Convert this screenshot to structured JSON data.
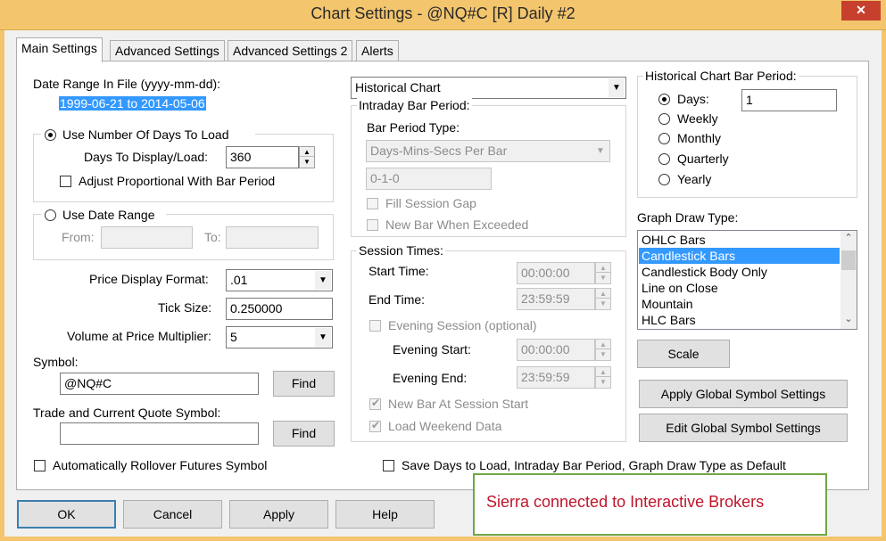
{
  "window": {
    "title": "Chart Settings - @NQ#C [R]  Daily  #2",
    "close_glyph": "✕"
  },
  "tabs": [
    "Main Settings",
    "Advanced Settings",
    "Advanced Settings 2",
    "Alerts"
  ],
  "main": {
    "date_range_label": "Date Range In File (yyyy-mm-dd):",
    "date_range_value": "1999-06-21 to 2014-05-06",
    "use_days_label": "Use Number Of Days To Load",
    "days_label": "Days To Display/Load:",
    "days_value": "360",
    "adjust_label": "Adjust Proportional With Bar Period",
    "use_date_range_label": "Use Date Range",
    "from_label": "From:",
    "to_label": "To:",
    "price_format_label": "Price Display Format:",
    "price_format_value": ".01",
    "tick_size_label": "Tick Size:",
    "tick_size_value": "0.250000",
    "volume_label": "Volume at Price Multiplier:",
    "volume_value": "5",
    "symbol_label": "Symbol:",
    "symbol_value": "@NQ#C",
    "find_label": "Find",
    "trade_symbol_label": "Trade and Current Quote Symbol:",
    "trade_symbol_value": "",
    "rollover_label": "Automatically Rollover Futures Symbol"
  },
  "middle": {
    "chart_type_value": "Historical Chart",
    "intraday_group": "Intraday Bar Period:",
    "bar_period_type_label": "Bar Period Type:",
    "bar_period_type_value": "Days-Mins-Secs Per Bar",
    "bar_period_value": "0-1-0",
    "fill_gap_label": "Fill Session Gap",
    "new_bar_exceeded_label": "New Bar When Exceeded",
    "session_group": "Session Times:",
    "start_time_label": "Start Time:",
    "start_time_value": "00:00:00",
    "end_time_label": "End Time:",
    "end_time_value": "23:59:59",
    "evening_session_label": "Evening Session (optional)",
    "evening_start_label": "Evening Start:",
    "evening_start_value": "00:00:00",
    "evening_end_label": "Evening End:",
    "evening_end_value": "23:59:59",
    "new_bar_session_label": "New Bar At Session Start",
    "load_weekend_label": "Load Weekend Data",
    "save_default_label": "Save Days to Load, Intraday Bar Period, Graph Draw Type as Default"
  },
  "right": {
    "hist_group": "Historical Chart Bar Period:",
    "days_label": "Days:",
    "days_value": "1",
    "weekly_label": "Weekly",
    "monthly_label": "Monthly",
    "quarterly_label": "Quarterly",
    "yearly_label": "Yearly",
    "graph_draw_label": "Graph Draw Type:",
    "draw_types": [
      "OHLC Bars",
      "Candlestick Bars",
      "Candlestick Body Only",
      "Line on Close",
      "Mountain",
      "HLC Bars"
    ],
    "selected_draw_type": "Candlestick Bars",
    "scale_label": "Scale",
    "apply_global_label": "Apply Global Symbol Settings",
    "edit_global_label": "Edit Global Symbol Settings"
  },
  "footer": {
    "ok_label": "OK",
    "cancel_label": "Cancel",
    "apply_label": "Apply",
    "help_label": "Help"
  },
  "annotation": {
    "text": "Sierra connected to Interactive Brokers"
  },
  "colors": {
    "title_bar": "#f3c56d",
    "selection": "#3399ff",
    "annotation_border": "#6fa843",
    "annotation_text": "#c0152a"
  }
}
